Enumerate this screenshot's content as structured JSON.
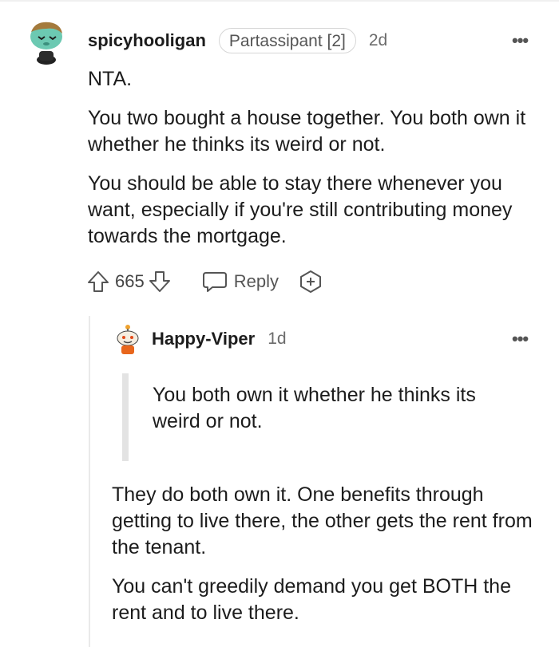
{
  "comment": {
    "avatar_icon": "snoo-avatar-icon",
    "username": "spicyhooligan",
    "flair": "Partassipant [2]",
    "age": "2d",
    "more_icon": "more-options-icon",
    "paragraphs": [
      "NTA.",
      "You two bought a house together. You both own it whether he thinks its weird or not.",
      "You should be able to stay there whenever you want, especially if you're still contributing money towards the mortgage."
    ],
    "actions": {
      "upvote_icon": "upvote-arrow-icon",
      "score": "665",
      "downvote_icon": "downvote-arrow-icon",
      "reply_icon": "speech-bubble-icon",
      "reply_label": "Reply",
      "award_icon": "award-plus-icon"
    }
  },
  "reply": {
    "avatar_icon": "snoo-avatar-icon",
    "username": "Happy-Viper",
    "age": "1d",
    "more_icon": "more-options-icon",
    "quote": "You both own it whether he thinks its weird or not.",
    "paragraphs": [
      "They do both own it. One benefits through getting to live there, the other gets the rent from the tenant.",
      "You can't greedily demand you get BOTH the rent and to live there."
    ]
  },
  "colors": {
    "text": "#1c1c1c",
    "muted": "#6b6b6b",
    "thread_line": "#eaeaea",
    "avatar_teal": "#5ec7b6"
  }
}
